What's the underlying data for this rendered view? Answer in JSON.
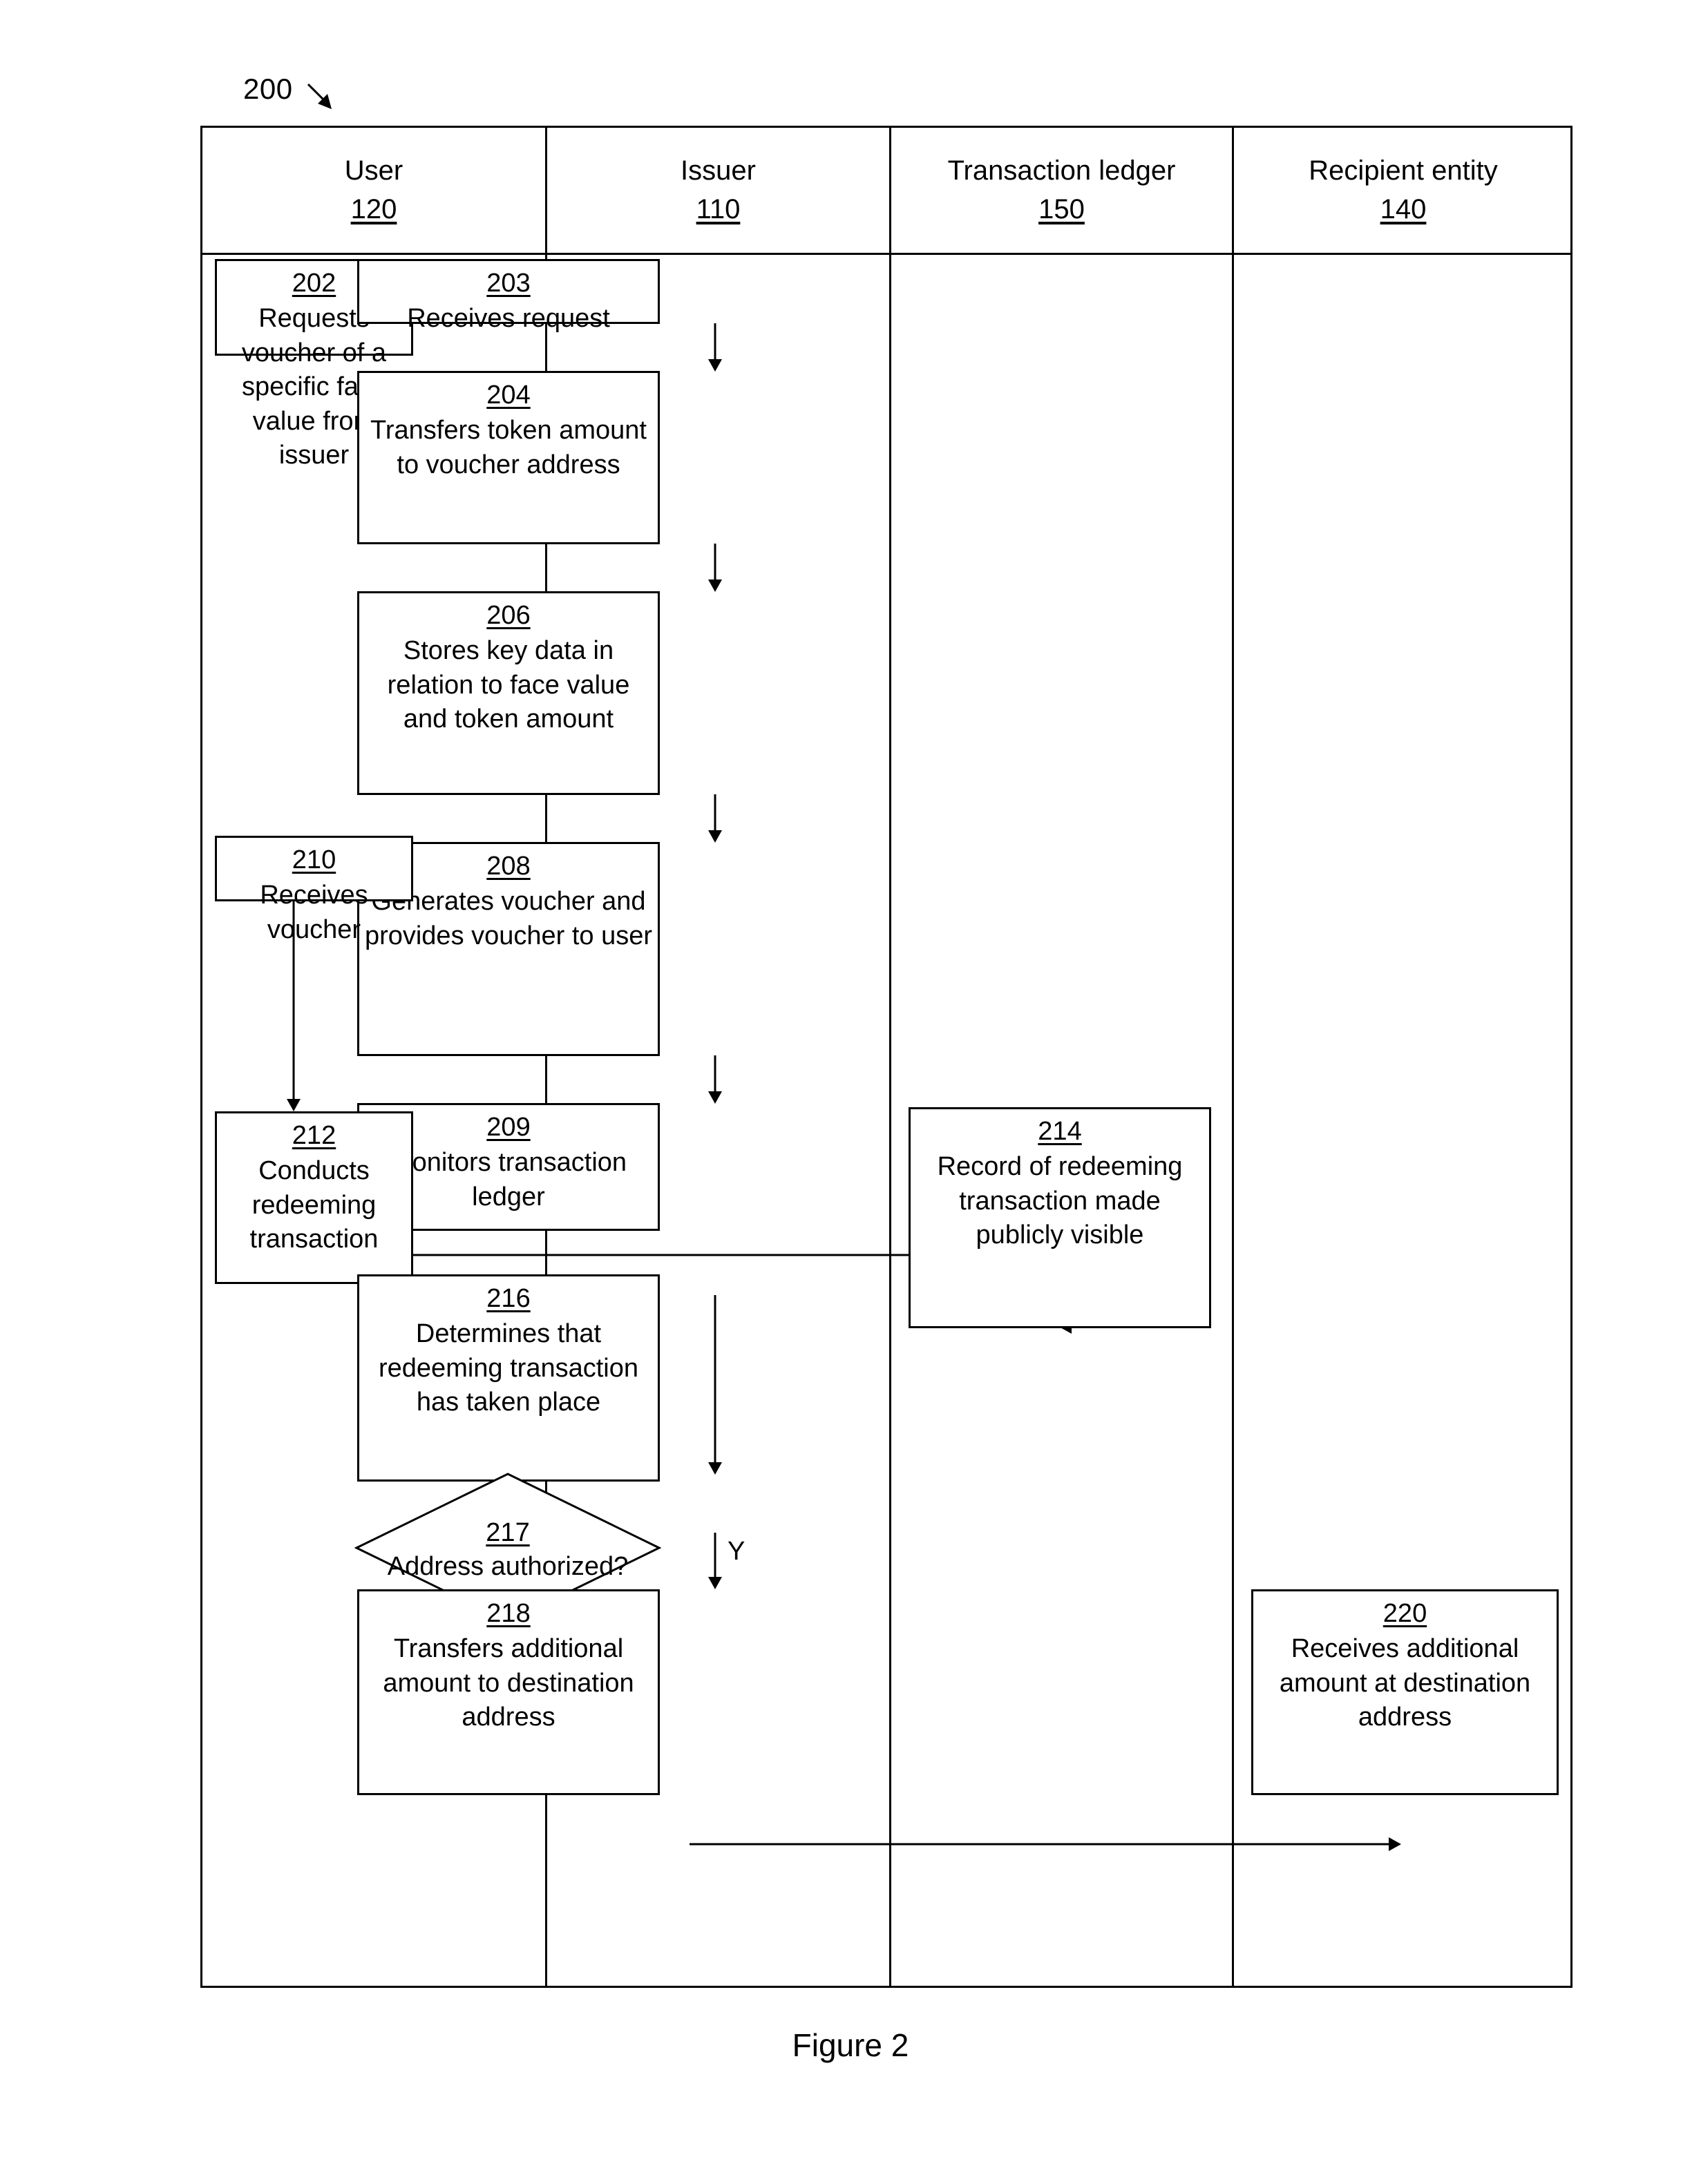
{
  "figure": {
    "reference_numeral": "200",
    "caption": "Figure 2"
  },
  "lanes": [
    {
      "title": "User",
      "number": "120"
    },
    {
      "title": "Issuer",
      "number": "110"
    },
    {
      "title": "Transaction ledger",
      "number": "150"
    },
    {
      "title": "Recipient entity",
      "number": "140"
    }
  ],
  "nodes": {
    "n202": {
      "number": "202",
      "text": "Requests voucher of a specific face value from issuer",
      "lane": "User",
      "shape": "process"
    },
    "n203": {
      "number": "203",
      "text": "Receives request",
      "lane": "Issuer",
      "shape": "process"
    },
    "n204": {
      "number": "204",
      "text": "Transfers token amount to voucher address",
      "lane": "Issuer",
      "shape": "process"
    },
    "n206": {
      "number": "206",
      "text": "Stores key data in relation to face value and token amount",
      "lane": "Issuer",
      "shape": "process"
    },
    "n208": {
      "number": "208",
      "text": "Generates voucher and provides voucher to user",
      "lane": "Issuer",
      "shape": "process"
    },
    "n209": {
      "number": "209",
      "text": "Monitors transaction ledger",
      "lane": "Issuer",
      "shape": "process"
    },
    "n210": {
      "number": "210",
      "text": "Receives voucher",
      "lane": "User",
      "shape": "process"
    },
    "n212": {
      "number": "212",
      "text": "Conducts redeeming transaction",
      "lane": "User",
      "shape": "process"
    },
    "n214": {
      "number": "214",
      "text": "Record of redeeming transaction made publicly visible",
      "lane": "Transaction ledger",
      "shape": "process"
    },
    "n216": {
      "number": "216",
      "text": "Determines that redeeming transaction has taken place",
      "lane": "Issuer",
      "shape": "process"
    },
    "n217": {
      "number": "217",
      "text": "Address authorized?",
      "lane": "Issuer",
      "shape": "decision"
    },
    "n218": {
      "number": "218",
      "text": "Transfers additional amount to destination address",
      "lane": "Issuer",
      "shape": "process"
    },
    "n220": {
      "number": "220",
      "text": "Receives additional amount at destination address",
      "lane": "Recipient entity",
      "shape": "process"
    }
  },
  "edges": {
    "e217_218_label": "Y"
  },
  "colors": {
    "stroke": "#000000",
    "background": "#ffffff"
  }
}
